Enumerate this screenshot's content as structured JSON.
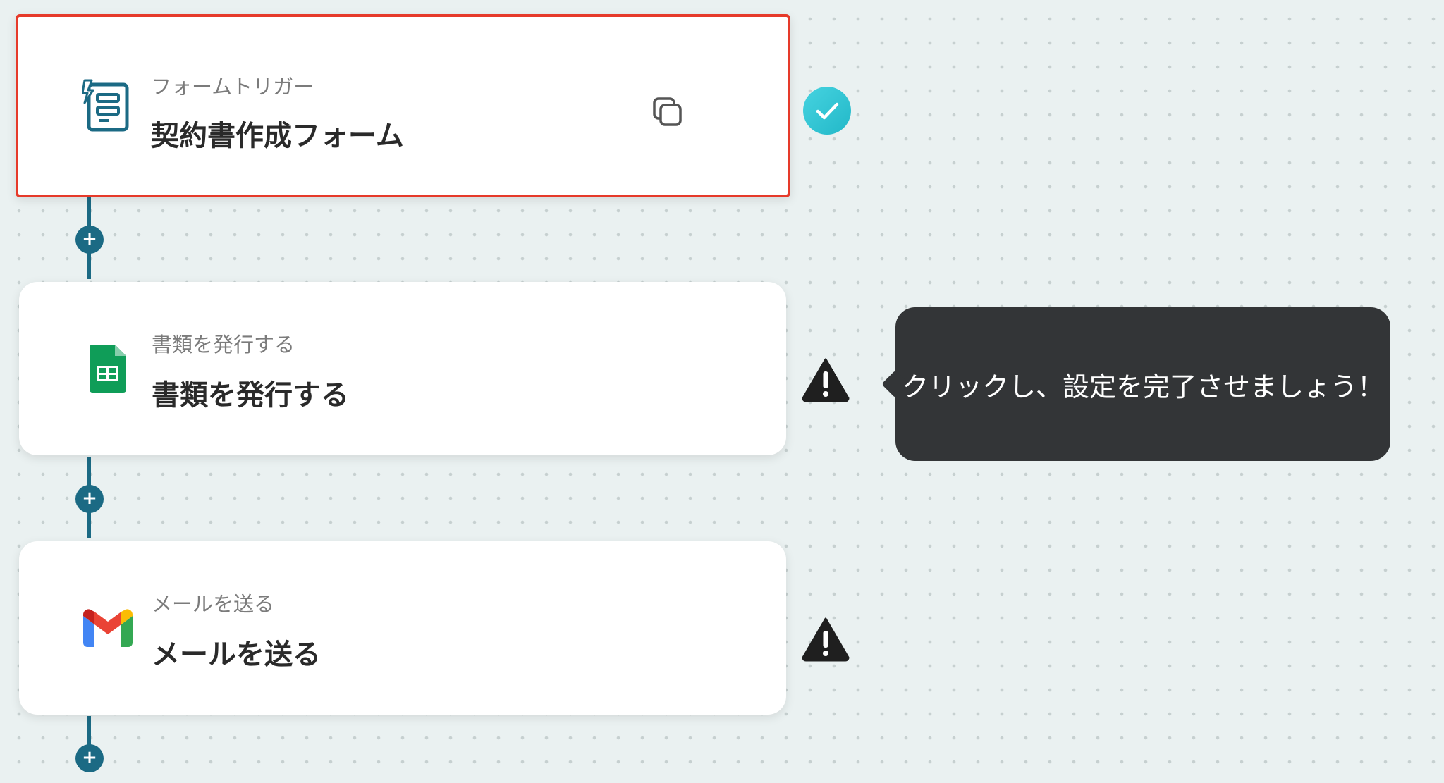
{
  "steps": [
    {
      "subtitle": "フォームトリガー",
      "title": "契約書作成フォーム",
      "icon": "form-trigger-icon",
      "status": "complete"
    },
    {
      "subtitle": "書類を発行する",
      "title": "書類を発行する",
      "icon": "google-sheets-icon",
      "status": "warning"
    },
    {
      "subtitle": "メールを送る",
      "title": "メールを送る",
      "icon": "gmail-icon",
      "status": "warning"
    }
  ],
  "tooltip": {
    "text": "クリックし、設定を完了させましょう！"
  },
  "colors": {
    "accent": "#1b6a84",
    "selected_border": "#e63a2a",
    "complete": "#2fc4d4",
    "warning": "#1f1f1f",
    "tooltip_bg": "#333537"
  }
}
